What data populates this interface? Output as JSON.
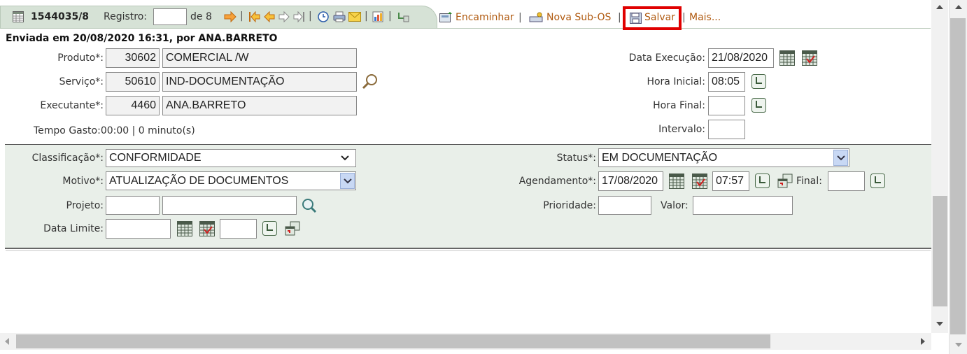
{
  "toolbar": {
    "record_id": "1544035/8",
    "registro_label": "Registro:",
    "registro_value": "",
    "of_total": "de 8",
    "encaminhar_label": "Encaminhar",
    "nova_subos_label": "Nova Sub-OS",
    "salvar_label": "Salvar",
    "mais_label": "Mais...",
    "separator": "|"
  },
  "header": {
    "sent_info": "Enviada em 20/08/2020 16:31, por ANA.BARRETO"
  },
  "top_form": {
    "produto_label": "Produto*:",
    "produto_code": "30602",
    "produto_name": "COMERCIAL /W",
    "servico_label": "Serviço*:",
    "servico_code": "50610",
    "servico_name": "IND-DOCUMENTAÇÃO",
    "executante_label": "Executante*:",
    "executante_code": "4460",
    "executante_name": "ANA.BARRETO",
    "tempo_gasto": "Tempo Gasto:00:00 | 0 minuto(s)",
    "data_execucao_label": "Data Execução:",
    "data_execucao_value": "21/08/2020",
    "hora_inicial_label": "Hora Inicial:",
    "hora_inicial_value": "08:05",
    "hora_final_label": "Hora Final:",
    "hora_final_value": "",
    "intervalo_label": "Intervalo:",
    "intervalo_value": ""
  },
  "detail_form": {
    "classificacao_label": "Classificação*:",
    "classificacao_value": "CONFORMIDADE",
    "motivo_label": "Motivo*:",
    "motivo_value": "ATUALIZAÇÃO DE DOCUMENTOS",
    "projeto_label": "Projeto:",
    "projeto_code": "",
    "projeto_name": "",
    "data_limite_label": "Data Limite:",
    "data_limite_value": "",
    "data_limite_hora": "",
    "status_label": "Status*:",
    "status_value": "EM DOCUMENTAÇÃO",
    "agendamento_label": "Agendamento*:",
    "agendamento_date": "17/08/2020",
    "agendamento_time": "07:57",
    "final_label": "Final:",
    "final_value": "",
    "prioridade_label": "Prioridade:",
    "prioridade_value": "",
    "valor_label": "Valor:",
    "valor_value": ""
  },
  "colors": {
    "panel_bg": "#e9efe9",
    "tab_bg": "#d6e2d6",
    "link_orange": "#b05a10",
    "highlight_red": "#e00000"
  }
}
